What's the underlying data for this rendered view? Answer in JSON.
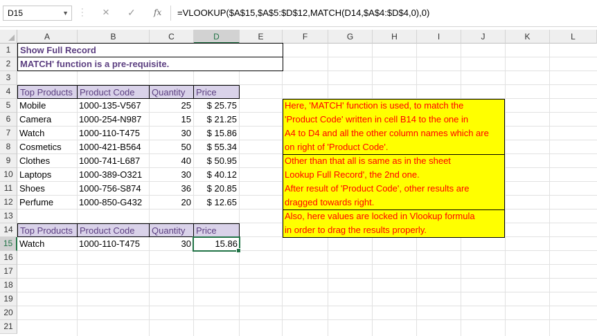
{
  "formula_bar": {
    "name_box": "D15",
    "cancel_icon": "×",
    "enter_icon": "✓",
    "fx_label": "fx",
    "formula": "=VLOOKUP($A$15,$A$5:$D$12,MATCH(D14,$A$4:$D$4,0),0)"
  },
  "columns": [
    "A",
    "B",
    "C",
    "D",
    "E",
    "F",
    "G",
    "H",
    "I",
    "J",
    "K",
    "L"
  ],
  "rows": [
    "1",
    "2",
    "3",
    "4",
    "5",
    "6",
    "7",
    "8",
    "9",
    "10",
    "11",
    "12",
    "13",
    "14",
    "15",
    "16",
    "17",
    "18",
    "19",
    "20",
    "21"
  ],
  "title_rows": {
    "r1": "Show Full Record",
    "r2": "MATCH' function is a pre-requisite."
  },
  "table1": {
    "headers": [
      "Top Products",
      "Product Code",
      "Quantity",
      "Price"
    ],
    "rows": [
      [
        "Mobile",
        "1000-135-V567",
        "25",
        "$ 25.75"
      ],
      [
        "Camera",
        "1000-254-N987",
        "15",
        "$ 21.25"
      ],
      [
        "Watch",
        "1000-110-T475",
        "30",
        "$ 15.86"
      ],
      [
        "Cosmetics",
        "1000-421-B564",
        "50",
        "$ 55.34"
      ],
      [
        "Clothes",
        "1000-741-L687",
        "40",
        "$ 50.95"
      ],
      [
        "Laptops",
        "1000-389-O321",
        "30",
        "$ 40.12"
      ],
      [
        "Shoes",
        "1000-756-S874",
        "36",
        "$ 20.85"
      ],
      [
        "Perfume",
        "1000-850-G432",
        "20",
        "$ 12.65"
      ]
    ]
  },
  "table2": {
    "headers": [
      "Top Products",
      "Product Code",
      "Quantity",
      "Price"
    ],
    "row": [
      "Watch",
      "1000-110-T475",
      "30",
      "15.86"
    ]
  },
  "notes": [
    [
      "Here, 'MATCH' function is used, to match the",
      " 'Product Code' written in cell B14 to the one in",
      "A4 to D4 and all the other column names which are",
      "on right of 'Product Code'."
    ],
    [
      "Other than that all is same as in the sheet",
      "Lookup Full Record', the 2nd one.",
      "After result of 'Product Code', other results are",
      "dragged towards right."
    ],
    [
      "Also, here values are locked in Vlookup formula",
      "in order to drag the results properly."
    ]
  ]
}
